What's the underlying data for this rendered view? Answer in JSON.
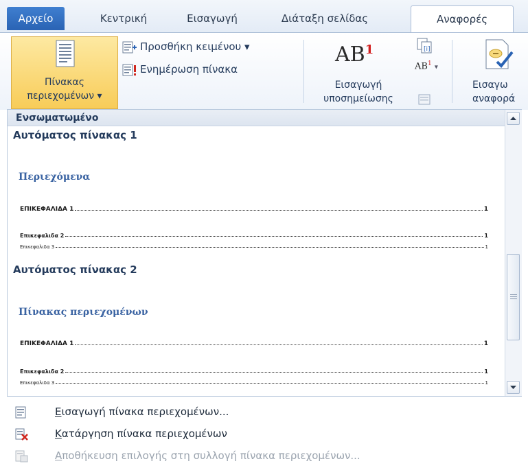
{
  "tabs": [
    {
      "label": "Αρχείο"
    },
    {
      "label": "Κεντρική"
    },
    {
      "label": "Εισαγωγή"
    },
    {
      "label": "Διάταξη σελίδας"
    },
    {
      "label": "Αναφορές"
    }
  ],
  "ribbon": {
    "toc_button": {
      "line1": "Πίνακας",
      "line2": "περιεχομένων ▾"
    },
    "add_text": "Προσθήκη κειμένου ▾",
    "update_table": "Ενημέρωση πίνακα",
    "footnote_big": {
      "ab": "AB",
      "sup": "1"
    },
    "insert_footnote": {
      "line1": "Εισαγωγή",
      "line2": "υποσημείωσης"
    },
    "next_footnote": {
      "ab": "AB",
      "sup": "1",
      "arrow": "▾"
    },
    "citation": {
      "line1": "Εισαγω",
      "line2": "αναφορά"
    }
  },
  "gallery": {
    "header": "Ενσωματωμένο",
    "entries": [
      {
        "title": "Αυτόματος πίνακας 1",
        "heading": "Περιεχόμενα",
        "lines": [
          {
            "text": "ΕΠΙΚΕΦΑΛΙΔΑ 1",
            "page": "1"
          },
          {
            "text": "Επικεφαλιδα 2",
            "page": "1"
          },
          {
            "text": "Επικεφαλιδα 3",
            "page": "1"
          }
        ]
      },
      {
        "title": "Αυτόματος πίνακας 2",
        "heading": "Πίνακας περιεχομένων",
        "lines": [
          {
            "text": "ΕΠΙΚΕΦΑΛΙΔΑ 1",
            "page": "1"
          },
          {
            "text": "Επικεφαλιδα 2",
            "page": "1"
          },
          {
            "text": "Επικεφαλιδα 3",
            "page": "1"
          }
        ]
      }
    ]
  },
  "menu": {
    "insert": {
      "mnemonic": "Ε",
      "rest": "ισαγωγή πίνακα περιεχομένων..."
    },
    "remove": {
      "mnemonic": "Κ",
      "rest": "ατάργηση πίνακα περιεχομένων"
    },
    "save": {
      "mnemonic": "Α",
      "rest": "ποθήκευση επιλογής στη συλλογή πίνακα περιεχομένων..."
    }
  },
  "colors": {
    "file_tab": "#2a63b4",
    "selected_button": "#f8cc58",
    "heading_blue": "#3a63a2",
    "remove_icon_x": "#d0261d"
  }
}
